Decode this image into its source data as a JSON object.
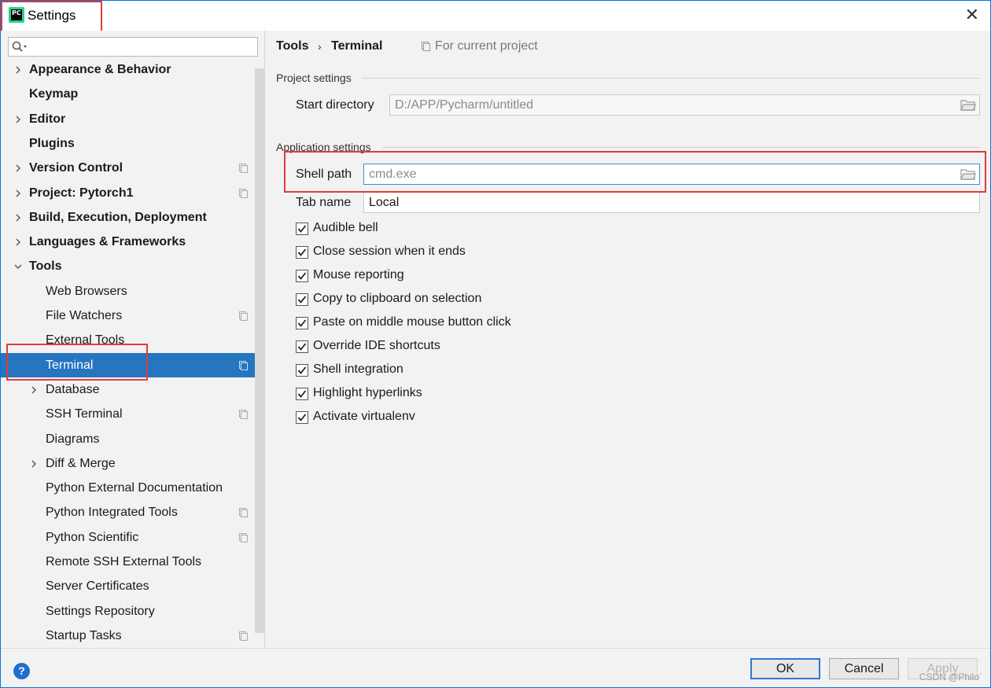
{
  "window": {
    "title": "Settings",
    "close_glyph": "✕",
    "app_icon_text": "PC"
  },
  "search": {
    "placeholder": "",
    "icon": "search-icon"
  },
  "sidebar": {
    "items": [
      {
        "label": "Appearance & Behavior",
        "bold": true,
        "chevron": "right",
        "level": 0
      },
      {
        "label": "Keymap",
        "bold": true,
        "chevron": "none",
        "level": 0
      },
      {
        "label": "Editor",
        "bold": true,
        "chevron": "right",
        "level": 0
      },
      {
        "label": "Plugins",
        "bold": true,
        "chevron": "none",
        "level": 0
      },
      {
        "label": "Version Control",
        "bold": true,
        "chevron": "right",
        "level": 0,
        "project_icon": true
      },
      {
        "label": "Project: Pytorch1",
        "bold": true,
        "chevron": "right",
        "level": 0,
        "project_icon": true
      },
      {
        "label": "Build, Execution, Deployment",
        "bold": true,
        "chevron": "right",
        "level": 0
      },
      {
        "label": "Languages & Frameworks",
        "bold": true,
        "chevron": "right",
        "level": 0
      },
      {
        "label": "Tools",
        "bold": true,
        "chevron": "down",
        "level": 0
      },
      {
        "label": "Web Browsers",
        "bold": false,
        "chevron": "none",
        "level": 1
      },
      {
        "label": "File Watchers",
        "bold": false,
        "chevron": "none",
        "level": 1,
        "project_icon": true
      },
      {
        "label": "External Tools",
        "bold": false,
        "chevron": "none",
        "level": 1
      },
      {
        "label": "Terminal",
        "bold": false,
        "chevron": "none",
        "level": 1,
        "project_icon": true,
        "selected": true
      },
      {
        "label": "Database",
        "bold": false,
        "chevron": "right",
        "level": 1
      },
      {
        "label": "SSH Terminal",
        "bold": false,
        "chevron": "none",
        "level": 1,
        "project_icon": true
      },
      {
        "label": "Diagrams",
        "bold": false,
        "chevron": "none",
        "level": 1
      },
      {
        "label": "Diff & Merge",
        "bold": false,
        "chevron": "right",
        "level": 1
      },
      {
        "label": "Python External Documentation",
        "bold": false,
        "chevron": "none",
        "level": 1
      },
      {
        "label": "Python Integrated Tools",
        "bold": false,
        "chevron": "none",
        "level": 1,
        "project_icon": true
      },
      {
        "label": "Python Scientific",
        "bold": false,
        "chevron": "none",
        "level": 1,
        "project_icon": true
      },
      {
        "label": "Remote SSH External Tools",
        "bold": false,
        "chevron": "none",
        "level": 1
      },
      {
        "label": "Server Certificates",
        "bold": false,
        "chevron": "none",
        "level": 1
      },
      {
        "label": "Settings Repository",
        "bold": false,
        "chevron": "none",
        "level": 1
      },
      {
        "label": "Startup Tasks",
        "bold": false,
        "chevron": "none",
        "level": 1,
        "project_icon": true
      }
    ]
  },
  "main": {
    "breadcrumb": [
      "Tools",
      "Terminal"
    ],
    "breadcrumb_sep": "›",
    "scope": "For current project",
    "project_section": "Project settings",
    "start_directory_label": "Start directory",
    "start_directory_value": "D:/APP/Pycharm/untitled",
    "app_section": "Application settings",
    "shell_path_label": "Shell path",
    "shell_path_value": "cmd.exe",
    "tab_name_label": "Tab name",
    "tab_name_value": "Local",
    "checkboxes": [
      {
        "label": "Audible bell",
        "checked": true
      },
      {
        "label": "Close session when it ends",
        "checked": true
      },
      {
        "label": "Mouse reporting",
        "checked": true
      },
      {
        "label": "Copy to clipboard on selection",
        "checked": true
      },
      {
        "label": "Paste on middle mouse button click",
        "checked": true
      },
      {
        "label": "Override IDE shortcuts",
        "checked": true
      },
      {
        "label": "Shell integration",
        "checked": true
      },
      {
        "label": "Highlight hyperlinks",
        "checked": true
      },
      {
        "label": "Activate virtualenv",
        "checked": true
      }
    ]
  },
  "footer": {
    "help": "?",
    "ok": "OK",
    "cancel": "Cancel",
    "apply": "Apply",
    "watermark": "CSDN @Philo`"
  },
  "colors": {
    "selection": "#2675bf",
    "highlight_box": "#e03b3b",
    "accent": "#2e78d2"
  }
}
